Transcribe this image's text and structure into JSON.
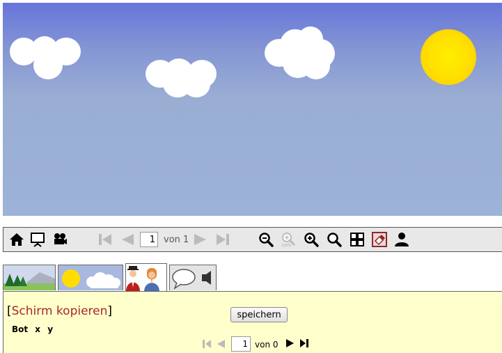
{
  "toolbar": {
    "page_value": "1",
    "page_of": "von 1",
    "icons": [
      "home-icon",
      "presentation-icon",
      "camera-icon",
      "first-page-icon",
      "previous-page-icon",
      "next-page-icon",
      "last-page-icon",
      "zoom-out-icon",
      "zoom-100-icon",
      "zoom-in-icon",
      "zoom-fit-icon",
      "grid-icon",
      "eraser-icon",
      "user-icon"
    ]
  },
  "tabs": {
    "items": [
      "landscape",
      "sky",
      "characters",
      "speech"
    ],
    "active_index": 2
  },
  "panel": {
    "copy_bracket_open": "[",
    "copy_link_label": "Schirm kopieren",
    "copy_bracket_close": "]",
    "columns_label": "Bot  x  y",
    "save_label": "speichern",
    "sub_page_value": "1",
    "sub_page_of": "von 0"
  },
  "colors": {
    "sky_top": "#6675da",
    "sky_bottom": "#9db2d8",
    "sun": "#ffdf00",
    "panel_bg": "#ffffcc",
    "link": "#a52a2a"
  }
}
